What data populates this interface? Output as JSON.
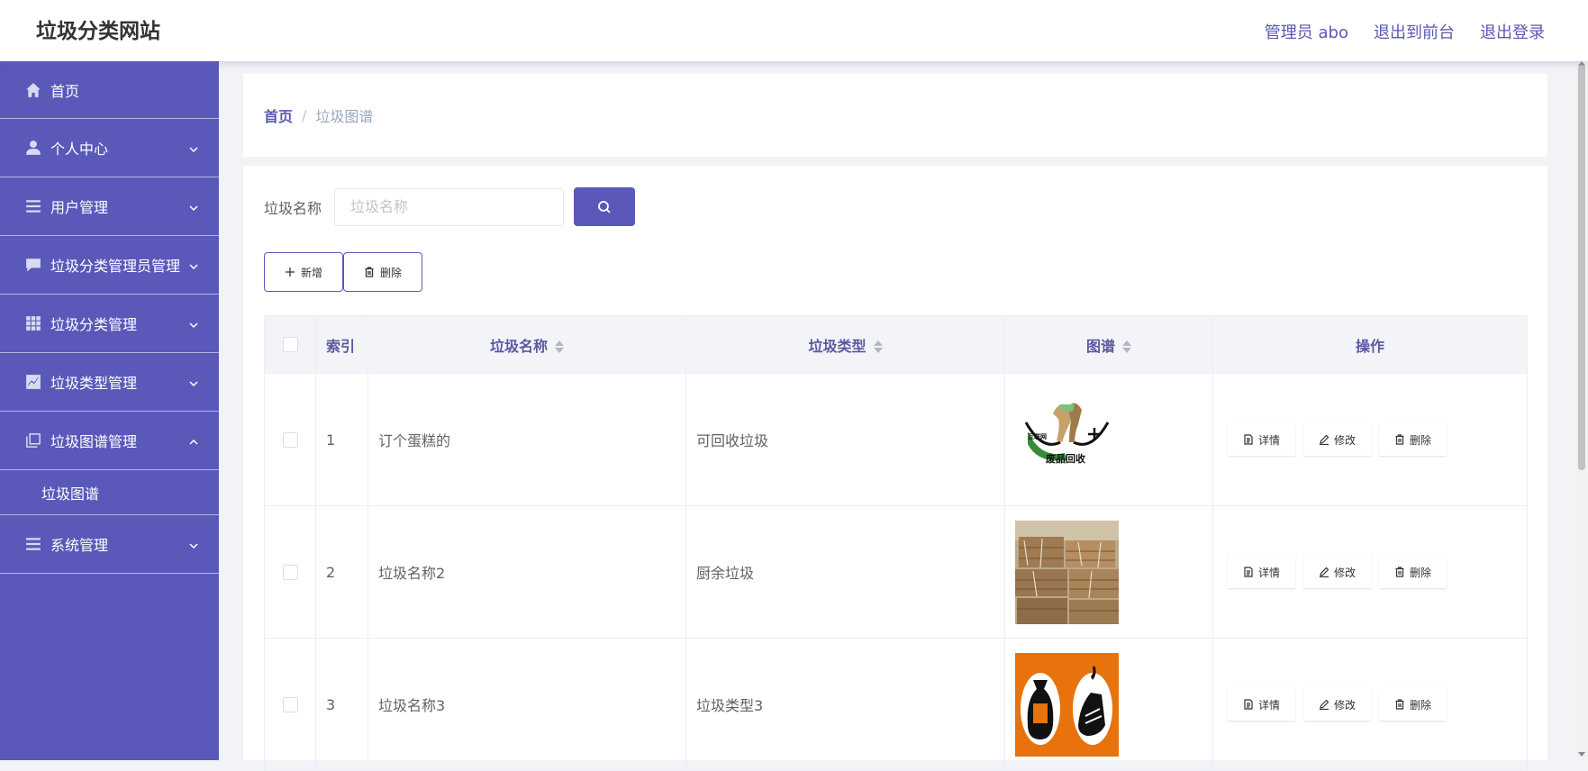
{
  "header": {
    "title": "垃圾分类网站",
    "admin": "管理员 abo",
    "to_front": "退出到前台",
    "logout": "退出登录"
  },
  "sidebar": {
    "items": [
      {
        "label": "首页",
        "icon": "home-icon"
      },
      {
        "label": "个人中心",
        "icon": "user-icon"
      },
      {
        "label": "用户管理",
        "icon": "list-icon"
      },
      {
        "label": "垃圾分类管理员管理",
        "icon": "message-icon"
      },
      {
        "label": "垃圾分类管理",
        "icon": "grid-icon"
      },
      {
        "label": "垃圾类型管理",
        "icon": "chart-icon"
      },
      {
        "label": "垃圾图谱管理",
        "icon": "copy-icon"
      },
      {
        "label": "系统管理",
        "icon": "list-icon"
      }
    ],
    "submenu_label": "垃圾图谱"
  },
  "breadcrumb": {
    "home": "首页",
    "separator": "/",
    "current": "垃圾图谱"
  },
  "search": {
    "label": "垃圾名称",
    "placeholder": "垃圾名称"
  },
  "actions": {
    "add": "新增",
    "delete": "删除"
  },
  "table": {
    "headers": {
      "index": "索引",
      "name": "垃圾名称",
      "type": "垃圾类型",
      "image": "图谱",
      "ops": "操作"
    },
    "rows": [
      {
        "index": "1",
        "name": "订个蛋糕的",
        "type": "可回收垃圾",
        "image_caption": "废品回收",
        "image_tag": "互联网"
      },
      {
        "index": "2",
        "name": "垃圾名称2",
        "type": "厨余垃圾"
      },
      {
        "index": "3",
        "name": "垃圾名称3",
        "type": "垃圾类型3"
      }
    ],
    "op_labels": {
      "detail": "详情",
      "edit": "修改",
      "delete": "删除"
    }
  },
  "colors": {
    "primary": "#5a59b9",
    "header_link": "#5a59b0",
    "table_header_bg": "#f3f4f8"
  }
}
